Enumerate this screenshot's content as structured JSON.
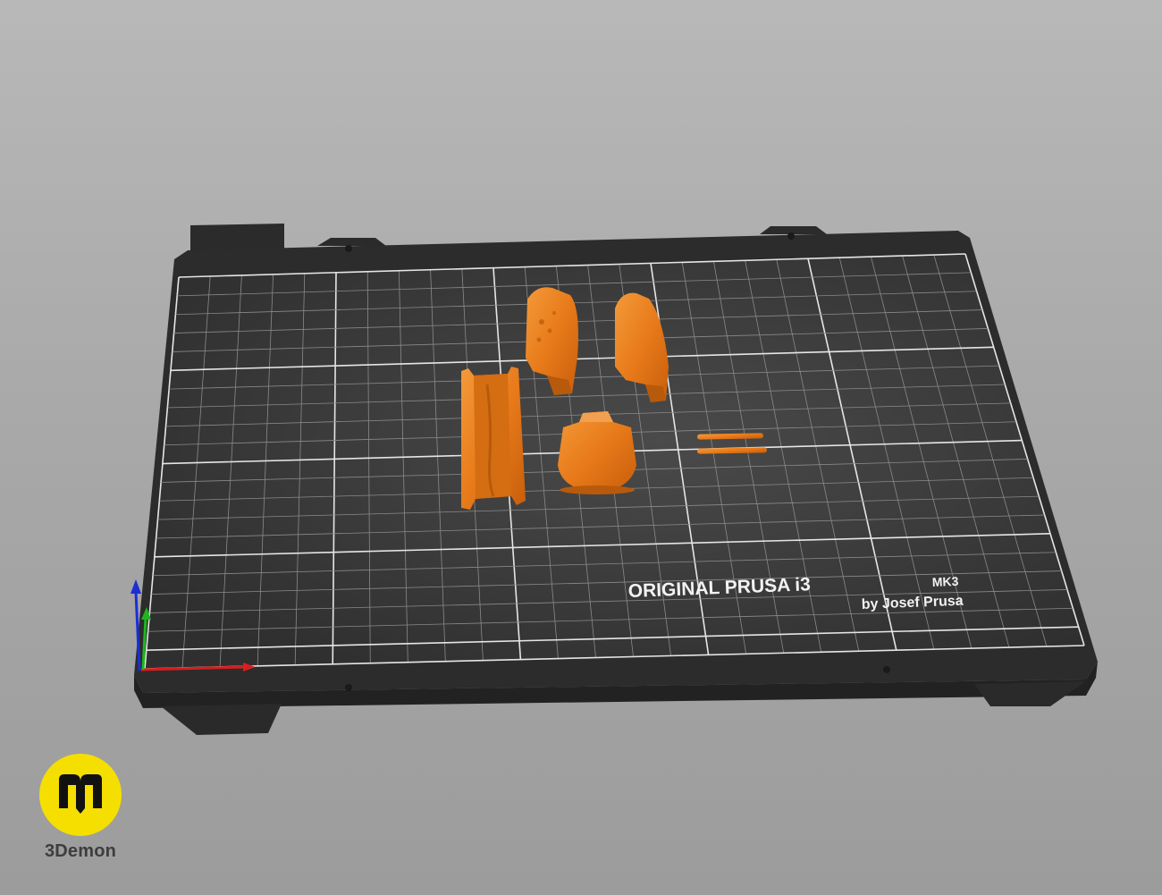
{
  "scene": {
    "printer_label_line1": "ORIGINAL PRUSA i3",
    "printer_label_model": "MK3",
    "printer_label_line2": "by Josef Prusa",
    "part_color": "#e87a1a",
    "bed_color": "#3a3a3a",
    "axis_colors": {
      "x": "#d81e1e",
      "y": "#1fb51f",
      "z": "#1a2fd6"
    }
  },
  "brand": {
    "name": "3Demon",
    "logo_color": "#f4df00"
  }
}
